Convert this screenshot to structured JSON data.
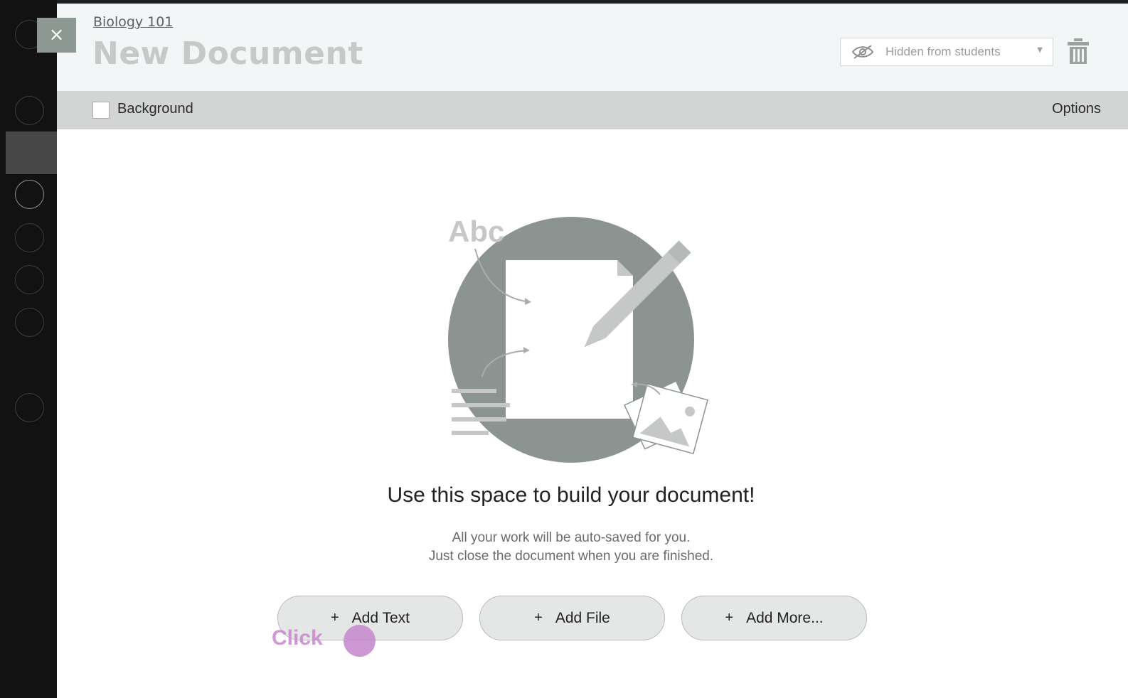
{
  "header": {
    "breadcrumb": "Biology 101",
    "title": "New Document",
    "visibility": {
      "label": "Hidden from students",
      "icon": "eye-slash-icon"
    },
    "close_icon": "×"
  },
  "toolbar": {
    "background_label": "Background",
    "background_checked": false,
    "options_label": "Options"
  },
  "illustration": {
    "abc_text": "Abc"
  },
  "empty_state": {
    "heading": "Use this space to build your document!",
    "line1": "All your work will be auto-saved for you.",
    "line2": "Just close the document when you are finished."
  },
  "buttons": {
    "add_text": "Add Text",
    "add_file": "Add File",
    "add_more": "Add More...",
    "plus": "+"
  },
  "cursor_hint": {
    "label": "Click"
  },
  "colors": {
    "sidebar": "#121212",
    "header_bg": "#f3f6f7",
    "toolbar_bg": "#d2d5d3",
    "illustration_gray": "#8b9491",
    "click_accent": "#c88ccf"
  }
}
